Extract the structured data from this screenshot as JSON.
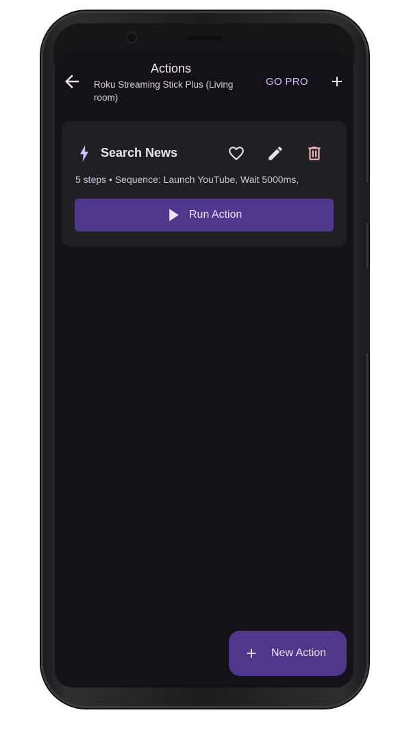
{
  "app_bar": {
    "title": "Actions",
    "subtitle": "Roku Streaming Stick Plus (Living room)",
    "go_pro_label": "GO PRO",
    "back_icon": "arrow-left-icon",
    "add_icon": "plus-icon"
  },
  "action_card": {
    "title": "Search News",
    "description": "5 steps • Sequence: Launch YouTube, Wait 5000ms,",
    "run_label": "Run Action",
    "icons": [
      "bolt-icon",
      "heart-outline-icon",
      "pencil-icon",
      "trash-icon",
      "play-icon"
    ]
  },
  "fab": {
    "label": "New Action",
    "icon": "plus-icon"
  },
  "colors": {
    "background": "#141218",
    "card": "#211f26",
    "primary_container": "#4f378b",
    "accent": "#cfbdfe",
    "delete": "#f2b8b5",
    "text": "#ece6f0"
  }
}
